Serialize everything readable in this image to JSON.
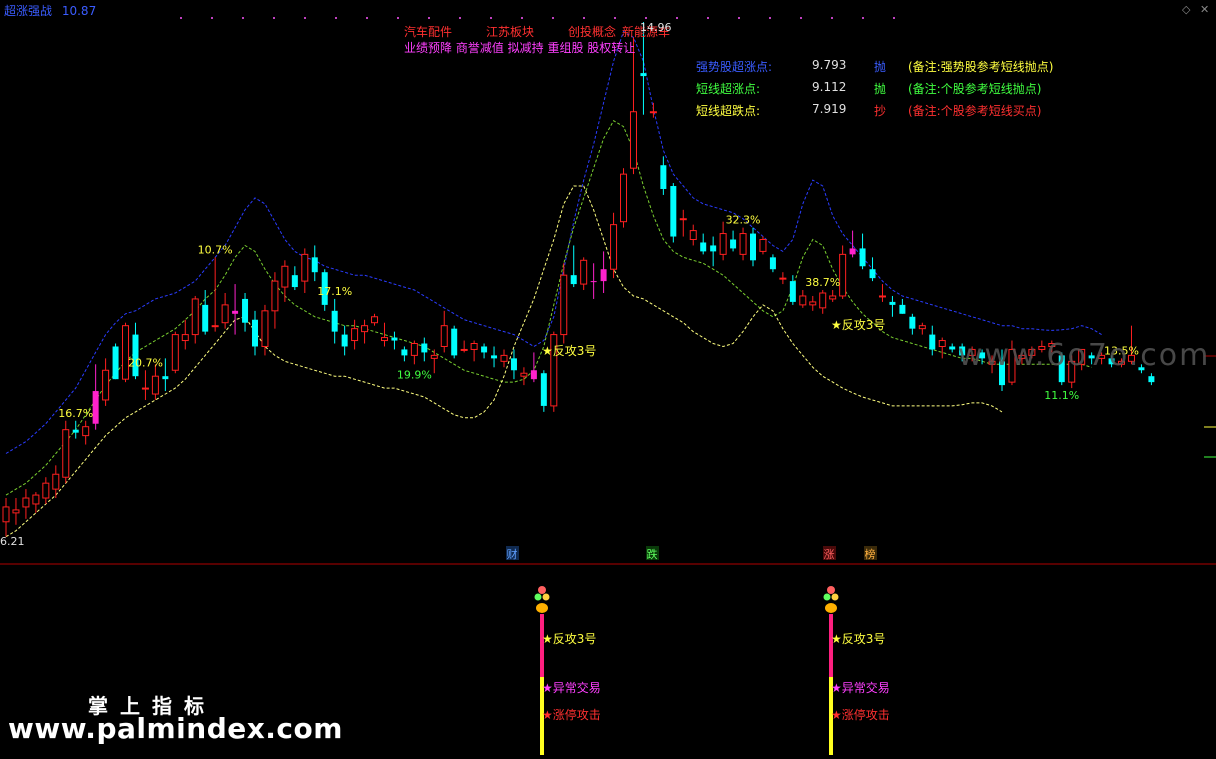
{
  "header": {
    "indicator_name": "超涨强战",
    "indicator_value": "10.87"
  },
  "concepts": {
    "line1": [
      "汽车配件",
      "江苏板块",
      "创投概念",
      "新能源车"
    ],
    "line2": "业绩预降 商誉减值 拟减持 重组股 股权转让"
  },
  "metrics": [
    {
      "label": "强势股超涨点:",
      "value": "9.793",
      "action": "抛",
      "note": "(备注:强势股参考短线抛点)",
      "label_color": "#3a5cff",
      "action_color": "#3a5cff",
      "note_color": "#ffff40"
    },
    {
      "label": "短线超涨点:",
      "value": "9.112",
      "action": "抛",
      "note": "(备注:个股参考短线抛点)",
      "label_color": "#40ff40",
      "action_color": "#40ff40",
      "note_color": "#40ff40"
    },
    {
      "label": "短线超跌点:",
      "value": "7.919",
      "action": "抄",
      "note": "(备注:个股参考短线买点)",
      "label_color": "#ffff40",
      "action_color": "#ff3030",
      "note_color": "#ff3030"
    }
  ],
  "price_labels": {
    "high": "14.96",
    "low": "6.21"
  },
  "markers": {
    "cai": "财",
    "die": "跌",
    "zhang": "涨",
    "bang": "榜"
  },
  "signals": {
    "fangong": "★反攻3号",
    "abnormal": "★异常交易",
    "limitup": "★涨停攻击"
  },
  "watermark": "www.6o7o.com",
  "brand": "掌上指标",
  "brand_url": "www.palmindex.com",
  "colors": {
    "up": "#ff2020",
    "down": "#00ffff",
    "limit_up": "#ff22cc",
    "upper_band": "#2a3cff",
    "mid_band": "#7ad030",
    "lower_band": "#ffff80",
    "pct_label": "#ffff40"
  },
  "chart_data": {
    "type": "candlestick",
    "title": "超涨强战",
    "ylim": [
      6.21,
      14.96
    ],
    "candles": [
      {
        "o": 6.55,
        "h": 6.95,
        "l": 6.3,
        "c": 6.8
      },
      {
        "o": 6.7,
        "h": 6.95,
        "l": 6.5,
        "c": 6.75
      },
      {
        "o": 6.8,
        "h": 7.1,
        "l": 6.6,
        "c": 6.95
      },
      {
        "o": 6.85,
        "h": 7.05,
        "l": 6.7,
        "c": 7.0
      },
      {
        "o": 6.95,
        "h": 7.3,
        "l": 6.85,
        "c": 7.2
      },
      {
        "o": 7.1,
        "h": 7.5,
        "l": 6.95,
        "c": 7.35
      },
      {
        "o": 7.3,
        "h": 8.25,
        "l": 7.2,
        "c": 8.1
      },
      {
        "o": 8.1,
        "h": 8.25,
        "l": 7.95,
        "c": 8.05
      },
      {
        "o": 8.0,
        "h": 8.25,
        "l": 7.85,
        "c": 8.15
      },
      {
        "o": 8.2,
        "h": 9.2,
        "l": 8.1,
        "c": 8.75
      },
      {
        "o": 8.6,
        "h": 9.3,
        "l": 8.5,
        "c": 9.1
      },
      {
        "o": 9.5,
        "h": 9.55,
        "l": 8.95,
        "c": 8.95
      },
      {
        "o": 8.95,
        "h": 9.9,
        "l": 8.9,
        "c": 9.85
      },
      {
        "o": 9.7,
        "h": 9.9,
        "l": 8.95,
        "c": 9.0
      },
      {
        "o": 8.8,
        "h": 9.1,
        "l": 8.6,
        "c": 8.8
      },
      {
        "o": 8.7,
        "h": 9.2,
        "l": 8.6,
        "c": 9.0
      },
      {
        "o": 9.0,
        "h": 9.3,
        "l": 8.75,
        "c": 8.95
      },
      {
        "o": 9.1,
        "h": 9.75,
        "l": 9.05,
        "c": 9.7
      },
      {
        "o": 9.6,
        "h": 9.95,
        "l": 9.45,
        "c": 9.7
      },
      {
        "o": 9.7,
        "h": 10.35,
        "l": 9.55,
        "c": 10.3
      },
      {
        "o": 10.2,
        "h": 10.45,
        "l": 9.7,
        "c": 9.75
      },
      {
        "o": 9.85,
        "h": 11.0,
        "l": 9.75,
        "c": 9.85
      },
      {
        "o": 9.9,
        "h": 10.4,
        "l": 9.8,
        "c": 10.2
      },
      {
        "o": 10.1,
        "h": 10.55,
        "l": 9.7,
        "c": 10.05
      },
      {
        "o": 10.3,
        "h": 10.4,
        "l": 9.75,
        "c": 9.9
      },
      {
        "o": 9.95,
        "h": 10.1,
        "l": 9.35,
        "c": 9.5
      },
      {
        "o": 9.5,
        "h": 10.2,
        "l": 9.35,
        "c": 10.1
      },
      {
        "o": 10.1,
        "h": 10.75,
        "l": 9.8,
        "c": 10.6
      },
      {
        "o": 10.5,
        "h": 10.95,
        "l": 10.25,
        "c": 10.85
      },
      {
        "o": 10.7,
        "h": 10.85,
        "l": 10.45,
        "c": 10.5
      },
      {
        "o": 10.6,
        "h": 11.15,
        "l": 10.4,
        "c": 11.05
      },
      {
        "o": 11.0,
        "h": 11.2,
        "l": 10.6,
        "c": 10.75
      },
      {
        "o": 10.75,
        "h": 10.8,
        "l": 10.1,
        "c": 10.2
      },
      {
        "o": 10.1,
        "h": 10.3,
        "l": 9.55,
        "c": 9.75
      },
      {
        "o": 9.7,
        "h": 9.85,
        "l": 9.35,
        "c": 9.5
      },
      {
        "o": 9.6,
        "h": 9.95,
        "l": 9.45,
        "c": 9.8
      },
      {
        "o": 9.75,
        "h": 9.95,
        "l": 9.55,
        "c": 9.85
      },
      {
        "o": 9.9,
        "h": 10.05,
        "l": 9.85,
        "c": 10.0
      },
      {
        "o": 9.6,
        "h": 9.9,
        "l": 9.5,
        "c": 9.65
      },
      {
        "o": 9.65,
        "h": 9.75,
        "l": 9.45,
        "c": 9.6
      },
      {
        "o": 9.45,
        "h": 9.5,
        "l": 9.25,
        "c": 9.35
      },
      {
        "o": 9.35,
        "h": 9.6,
        "l": 9.2,
        "c": 9.55
      },
      {
        "o": 9.55,
        "h": 9.65,
        "l": 9.25,
        "c": 9.4
      },
      {
        "o": 9.3,
        "h": 9.45,
        "l": 9.05,
        "c": 9.35
      },
      {
        "o": 9.5,
        "h": 10.1,
        "l": 9.4,
        "c": 9.85
      },
      {
        "o": 9.8,
        "h": 9.85,
        "l": 9.3,
        "c": 9.35
      },
      {
        "o": 9.45,
        "h": 9.6,
        "l": 9.4,
        "c": 9.45
      },
      {
        "o": 9.45,
        "h": 9.6,
        "l": 9.25,
        "c": 9.55
      },
      {
        "o": 9.5,
        "h": 9.55,
        "l": 9.3,
        "c": 9.4
      },
      {
        "o": 9.35,
        "h": 9.5,
        "l": 9.15,
        "c": 9.3
      },
      {
        "o": 9.25,
        "h": 9.45,
        "l": 9.15,
        "c": 9.35
      },
      {
        "o": 9.3,
        "h": 9.45,
        "l": 8.95,
        "c": 9.1
      },
      {
        "o": 9.0,
        "h": 9.15,
        "l": 8.85,
        "c": 9.05
      },
      {
        "o": 8.95,
        "h": 9.4,
        "l": 8.9,
        "c": 9.1
      },
      {
        "o": 9.05,
        "h": 9.1,
        "l": 8.4,
        "c": 8.5
      },
      {
        "o": 8.5,
        "h": 9.75,
        "l": 8.4,
        "c": 9.7
      },
      {
        "o": 9.7,
        "h": 10.9,
        "l": 9.55,
        "c": 10.7
      },
      {
        "o": 10.7,
        "h": 11.2,
        "l": 10.5,
        "c": 10.55
      },
      {
        "o": 10.55,
        "h": 11.0,
        "l": 10.45,
        "c": 10.95
      },
      {
        "o": 10.6,
        "h": 10.9,
        "l": 10.3,
        "c": 10.6
      },
      {
        "o": 10.6,
        "h": 11.1,
        "l": 10.4,
        "c": 10.8
      },
      {
        "o": 10.8,
        "h": 11.75,
        "l": 10.65,
        "c": 11.55
      },
      {
        "o": 11.6,
        "h": 12.5,
        "l": 11.5,
        "c": 12.4
      },
      {
        "o": 12.5,
        "h": 14.7,
        "l": 12.4,
        "c": 13.45
      },
      {
        "o": 14.1,
        "h": 14.96,
        "l": 13.4,
        "c": 14.05
      },
      {
        "o": 13.45,
        "h": 13.6,
        "l": 13.35,
        "c": 13.45
      },
      {
        "o": 12.55,
        "h": 12.7,
        "l": 12.05,
        "c": 12.15
      },
      {
        "o": 12.2,
        "h": 12.25,
        "l": 11.25,
        "c": 11.35
      },
      {
        "o": 11.65,
        "h": 11.8,
        "l": 11.35,
        "c": 11.65
      },
      {
        "o": 11.3,
        "h": 11.55,
        "l": 11.2,
        "c": 11.45
      },
      {
        "o": 11.25,
        "h": 11.4,
        "l": 11.05,
        "c": 11.1
      },
      {
        "o": 11.2,
        "h": 11.35,
        "l": 10.85,
        "c": 11.1
      },
      {
        "o": 11.05,
        "h": 11.6,
        "l": 10.95,
        "c": 11.4
      },
      {
        "o": 11.3,
        "h": 11.45,
        "l": 11.1,
        "c": 11.15
      },
      {
        "o": 11.05,
        "h": 11.5,
        "l": 10.95,
        "c": 11.4
      },
      {
        "o": 11.4,
        "h": 11.5,
        "l": 10.85,
        "c": 10.95
      },
      {
        "o": 11.1,
        "h": 11.35,
        "l": 11.05,
        "c": 11.3
      },
      {
        "o": 11.0,
        "h": 11.05,
        "l": 10.75,
        "c": 10.8
      },
      {
        "o": 10.65,
        "h": 10.75,
        "l": 10.55,
        "c": 10.65
      },
      {
        "o": 10.6,
        "h": 10.7,
        "l": 10.2,
        "c": 10.25
      },
      {
        "o": 10.2,
        "h": 10.45,
        "l": 10.15,
        "c": 10.35
      },
      {
        "o": 10.2,
        "h": 10.35,
        "l": 10.1,
        "c": 10.25
      },
      {
        "o": 10.15,
        "h": 10.45,
        "l": 10.05,
        "c": 10.4
      },
      {
        "o": 10.3,
        "h": 10.45,
        "l": 10.25,
        "c": 10.35
      },
      {
        "o": 10.35,
        "h": 11.2,
        "l": 10.3,
        "c": 11.05
      },
      {
        "o": 11.05,
        "h": 11.45,
        "l": 11.0,
        "c": 11.15
      },
      {
        "o": 11.15,
        "h": 11.4,
        "l": 10.8,
        "c": 10.85
      },
      {
        "o": 10.8,
        "h": 11.0,
        "l": 10.6,
        "c": 10.65
      },
      {
        "o": 10.35,
        "h": 10.55,
        "l": 10.25,
        "c": 10.35
      },
      {
        "o": 10.25,
        "h": 10.35,
        "l": 10.0,
        "c": 10.2
      },
      {
        "o": 10.2,
        "h": 10.3,
        "l": 10.05,
        "c": 10.05
      },
      {
        "o": 10.0,
        "h": 10.05,
        "l": 9.7,
        "c": 9.8
      },
      {
        "o": 9.8,
        "h": 9.9,
        "l": 9.7,
        "c": 9.85
      },
      {
        "o": 9.7,
        "h": 9.85,
        "l": 9.35,
        "c": 9.45
      },
      {
        "o": 9.5,
        "h": 9.65,
        "l": 9.3,
        "c": 9.6
      },
      {
        "o": 9.5,
        "h": 9.55,
        "l": 9.4,
        "c": 9.45
      },
      {
        "o": 9.5,
        "h": 9.55,
        "l": 9.25,
        "c": 9.35
      },
      {
        "o": 9.35,
        "h": 9.5,
        "l": 9.25,
        "c": 9.45
      },
      {
        "o": 9.4,
        "h": 9.45,
        "l": 9.2,
        "c": 9.3
      },
      {
        "o": 9.2,
        "h": 9.35,
        "l": 9.05,
        "c": 9.25
      },
      {
        "o": 9.25,
        "h": 9.45,
        "l": 8.75,
        "c": 8.85
      },
      {
        "o": 8.9,
        "h": 9.6,
        "l": 8.85,
        "c": 9.45
      },
      {
        "o": 9.3,
        "h": 9.4,
        "l": 9.2,
        "c": 9.35
      },
      {
        "o": 9.35,
        "h": 9.5,
        "l": 9.3,
        "c": 9.45
      },
      {
        "o": 9.45,
        "h": 9.6,
        "l": 9.4,
        "c": 9.5
      },
      {
        "o": 9.5,
        "h": 9.6,
        "l": 9.4,
        "c": 9.55
      },
      {
        "o": 9.35,
        "h": 9.4,
        "l": 8.85,
        "c": 8.9
      },
      {
        "o": 8.9,
        "h": 9.35,
        "l": 8.8,
        "c": 9.25
      },
      {
        "o": 9.2,
        "h": 9.45,
        "l": 9.1,
        "c": 9.45
      },
      {
        "o": 9.35,
        "h": 9.4,
        "l": 9.2,
        "c": 9.3
      },
      {
        "o": 9.3,
        "h": 9.4,
        "l": 9.2,
        "c": 9.35
      },
      {
        "o": 9.3,
        "h": 9.35,
        "l": 9.15,
        "c": 9.2
      },
      {
        "o": 9.2,
        "h": 9.3,
        "l": 9.15,
        "c": 9.25
      },
      {
        "o": 9.25,
        "h": 9.85,
        "l": 9.2,
        "c": 9.35
      },
      {
        "o": 9.15,
        "h": 9.2,
        "l": 9.05,
        "c": 9.1
      },
      {
        "o": 9.0,
        "h": 9.05,
        "l": 8.85,
        "c": 8.9
      }
    ],
    "limit_up_days": [
      9,
      23,
      53,
      59,
      60,
      85
    ],
    "upper_band": [
      7.7,
      7.8,
      7.9,
      8.05,
      8.2,
      8.4,
      8.6,
      8.8,
      9.1,
      9.4,
      9.7,
      9.9,
      10.05,
      10.1,
      10.2,
      10.3,
      10.35,
      10.4,
      10.5,
      10.6,
      10.8,
      11.0,
      11.2,
      11.5,
      11.8,
      12.0,
      11.9,
      11.6,
      11.3,
      11.1,
      11.0,
      10.95,
      10.85,
      10.8,
      10.75,
      10.7,
      10.7,
      10.65,
      10.6,
      10.55,
      10.5,
      10.45,
      10.35,
      10.25,
      10.15,
      10.05,
      9.95,
      9.9,
      9.85,
      9.8,
      9.75,
      9.7,
      9.6,
      9.5,
      9.6,
      10.0,
      10.8,
      11.6,
      12.3,
      12.9,
      13.6,
      14.3,
      14.8,
      14.7,
      14.3,
      13.5,
      12.8,
      12.4,
      12.2,
      12.0,
      11.9,
      11.85,
      11.8,
      11.75,
      11.65,
      11.5,
      11.35,
      11.2,
      11.1,
      11.3,
      11.9,
      12.3,
      12.2,
      11.7,
      11.4,
      11.2,
      11.0,
      10.8,
      10.6,
      10.45,
      10.35,
      10.3,
      10.25,
      10.2,
      10.15,
      10.1,
      10.05,
      10.0,
      9.95,
      9.9,
      9.85,
      9.85,
      9.8,
      9.8,
      9.78,
      9.77,
      9.78,
      9.8,
      9.85,
      9.8,
      9.7
    ],
    "mid_band": [
      7.0,
      7.1,
      7.2,
      7.35,
      7.5,
      7.7,
      7.9,
      8.1,
      8.35,
      8.6,
      8.85,
      9.05,
      9.25,
      9.4,
      9.5,
      9.6,
      9.7,
      9.8,
      9.95,
      10.1,
      10.3,
      10.45,
      10.7,
      11.0,
      11.2,
      11.1,
      10.8,
      10.55,
      10.35,
      10.2,
      10.1,
      10.0,
      9.95,
      9.9,
      9.85,
      9.85,
      9.8,
      9.75,
      9.7,
      9.65,
      9.6,
      9.55,
      9.5,
      9.4,
      9.3,
      9.2,
      9.1,
      9.05,
      9.0,
      8.95,
      8.9,
      8.9,
      8.95,
      9.1,
      9.5,
      10.2,
      10.9,
      11.5,
      12.0,
      12.5,
      13.0,
      13.3,
      13.2,
      12.8,
      12.2,
      11.7,
      11.3,
      11.1,
      11.0,
      10.95,
      10.9,
      10.8,
      10.7,
      10.55,
      10.4,
      10.25,
      10.1,
      10.0,
      10.1,
      10.5,
      11.0,
      11.3,
      11.2,
      10.8,
      10.5,
      10.25,
      10.05,
      9.9,
      9.75,
      9.65,
      9.6,
      9.55,
      9.5,
      9.45,
      9.4,
      9.35,
      9.3,
      9.3,
      9.25,
      9.2,
      9.2,
      9.2,
      9.2,
      9.2,
      9.2,
      9.2,
      9.2,
      9.2,
      9.2,
      9.15
    ],
    "lower_band": [
      6.3,
      6.4,
      6.55,
      6.7,
      6.85,
      7.0,
      7.2,
      7.4,
      7.6,
      7.8,
      8.0,
      8.15,
      8.3,
      8.4,
      8.5,
      8.6,
      8.7,
      8.8,
      8.95,
      9.15,
      9.35,
      9.55,
      9.75,
      9.95,
      10.0,
      9.75,
      9.5,
      9.35,
      9.25,
      9.2,
      9.15,
      9.1,
      9.05,
      9.0,
      9.0,
      8.95,
      8.9,
      8.85,
      8.8,
      8.8,
      8.75,
      8.7,
      8.65,
      8.55,
      8.45,
      8.35,
      8.3,
      8.3,
      8.4,
      8.6,
      9.0,
      9.5,
      9.9,
      10.3,
      10.8,
      11.3,
      11.9,
      12.2,
      12.2,
      11.8,
      11.3,
      10.8,
      10.5,
      10.35,
      10.3,
      10.2,
      10.1,
      10.0,
      9.9,
      9.75,
      9.65,
      9.55,
      9.5,
      9.55,
      9.75,
      10.0,
      10.2,
      10.1,
      9.8,
      9.55,
      9.35,
      9.15,
      9.0,
      8.9,
      8.8,
      8.72,
      8.65,
      8.6,
      8.55,
      8.5,
      8.5,
      8.5,
      8.5,
      8.5,
      8.5,
      8.5,
      8.52,
      8.55,
      8.55,
      8.5,
      8.4
    ],
    "pct_labels": [
      {
        "i": 7,
        "text": "16.7%",
        "pos": "above"
      },
      {
        "i": 14,
        "text": "20.7%",
        "pos": "above"
      },
      {
        "i": 21,
        "text": "10.7%",
        "pos": "above"
      },
      {
        "i": 33,
        "text": "17.1%",
        "pos": "above"
      },
      {
        "i": 41,
        "text": "19.9%",
        "pos": "below"
      },
      {
        "i": 74,
        "text": "32.3%",
        "pos": "above"
      },
      {
        "i": 82,
        "text": "38.7%",
        "pos": "above"
      },
      {
        "i": 106,
        "text": "11.1%",
        "pos": "below"
      },
      {
        "i": 112,
        "text": "13.5%",
        "pos": "above"
      }
    ]
  }
}
